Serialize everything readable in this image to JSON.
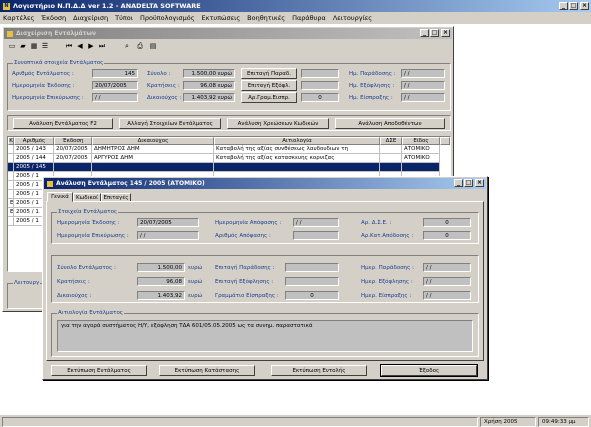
{
  "app": {
    "title": "Λογιστήριο Ν.Π.Δ.Δ  ver 1.2  -  ANADELTA SOFTWARE"
  },
  "menu": [
    "Καρτέλες",
    "Έκδοση",
    "Διαχείριση",
    "Τύποι",
    "Προϋπολογισμός",
    "Εκτυπώσεις",
    "Βοηθητικές",
    "Παράθυρα",
    "Λειτουργίες"
  ],
  "toolbar_icons": [
    "new-icon",
    "open-icon",
    "grid-icon",
    "table-icon",
    "first-record-icon",
    "prev-record-icon",
    "next-record-icon",
    "last-record-icon",
    "search-icon",
    "print-icon",
    "preview-icon"
  ],
  "mgmt": {
    "title": "Διαχείριση Ενταλμάτων",
    "group": "Συνοπτικά στοιχεία Εντάλματος",
    "fields": {
      "arithmos_label": "Αριθμός Εντάλματος :",
      "arithmos": "145",
      "ekdosi_label": "Ημερομηνία Έκδοσης :",
      "ekdosi": "20/07/2005",
      "epikyrosi_label": "Ημερομηνία Επικύρωσης :",
      "epikyrosi": "/ /",
      "synolo_label": "Σύνολο :",
      "synolo": "1.500,00 ευρώ",
      "kratiseis_label": "Κρατήσεις :",
      "kratiseis": "96,08 ευρώ",
      "dikaiouxos_label": "Δικαιούχος :",
      "dikaiouxos": "1.403,92 ευρώ",
      "epikt_parod_btn": "Επιταγή Παραδ.",
      "epikt_exof_btn": "Επιταγή Εξόφλ.",
      "ar_gram_btn": "Αρ.Γραμ.Εισπρ.",
      "ar_gram_val": "0",
      "parodosi_label": "Ημ. Παράδοσης :",
      "parodosi": "/ /",
      "exoflisi_label": "Ημ. Εξόφλησης :",
      "exoflisi": "/ /",
      "eispraxi_label": "Ημ. Είσπραξης :",
      "eispraxi": "/ /"
    },
    "buttons": [
      "Ανάλυση Εντάλματος   F2",
      "Αλλαγή Στοιχείων Εντάλματος",
      "Ανάλυση Χρεώσεων Κωδικών",
      "Ανάλυση Αποδοθέντων"
    ],
    "table": {
      "columns": [
        "Κ",
        "Αριθμός",
        "Έκδοση",
        "Δικαιούχος",
        "Αιτιολογία",
        "ΔΣΕ",
        "Είδος"
      ],
      "rows": [
        {
          "k": "",
          "num": "2005 / 143",
          "date": "20/07/2005",
          "who": "ΔΗΜΗΤΡΟΣ ΔΗΜ",
          "why": "Καταβολή της αξίας συνθέσεως λαυδουδιων τη",
          "dse": "",
          "kind": "ΑΤΟΜΙΚΟ"
        },
        {
          "k": "",
          "num": "2005 / 144",
          "date": "20/07/2005",
          "who": "ΑΡΓΥΡΟΣ ΔΗΜ",
          "why": "Καταβολή της αξίας κατασκευης  κορνιζας",
          "dse": "",
          "kind": "ΑΤΟΜΙΚΟ"
        },
        {
          "k": "",
          "num": "2005 / 145",
          "date": "",
          "who": "",
          "why": "",
          "dse": "",
          "kind": ""
        },
        {
          "k": "",
          "num": "2005 / 1",
          "date": "",
          "who": "",
          "why": "",
          "dse": "",
          "kind": ""
        },
        {
          "k": "",
          "num": "2005 / 1",
          "date": "",
          "who": "",
          "why": "",
          "dse": "",
          "kind": ""
        },
        {
          "k": "",
          "num": "2005 / 1",
          "date": "",
          "who": "",
          "why": "",
          "dse": "",
          "kind": ""
        },
        {
          "k": "Ε",
          "num": "2005 / 1",
          "date": "",
          "who": "",
          "why": "",
          "dse": "",
          "kind": ""
        },
        {
          "k": "Ε",
          "num": "2005 / 1",
          "date": "",
          "who": "",
          "why": "",
          "dse": "",
          "kind": ""
        },
        {
          "k": "",
          "num": "2005 / 1",
          "date": "",
          "who": "",
          "why": "",
          "dse": "",
          "kind": ""
        }
      ]
    },
    "bottom_group": "Λειτουργ"
  },
  "dialog": {
    "title": "Ανάλυση Εντάλματος 145 / 2005  (ΑΤΟΜΙΚΟ)",
    "tabs": [
      "Γενικά",
      "Κωδικοί",
      "Επιταγές"
    ],
    "g1_title": "Στοιχεία Εντάλματος",
    "ekdosi_label": "Ημερομηνία Έκδοσης :",
    "ekdosi": "20/07/2005",
    "epikyrosi_label": "Ημερομηνία Επικύρωσης :",
    "epikyrosi": "/ /",
    "apofasi_date_label": "Ημερομηνία Απόφασης :",
    "apofasi_date": "/ /",
    "apofasi_num_label": "Αριθμός Απόφασης :",
    "apofasi_num": "",
    "dse_label": "Αρ. Δ.Σ.Ε. :",
    "dse": "0",
    "ar_kat_label": "Αρ.Κατ.Απόδοσης :",
    "ar_kat": "0",
    "synolo_label": "Σύνολο Εντάλματος :",
    "synolo": "1.500,00",
    "kratiseis_label": "Κρατήσεις :",
    "kratiseis": "96,08",
    "dikaiouxos_label": "Δικαιούχος :",
    "dikaiouxos": "1.403,92",
    "euro": "ευρώ",
    "ep_parod_label": "Επιταγή Παράδοσης :",
    "ep_parod": "",
    "ep_exof_label": "Επιταγή Εξόφλησης :",
    "ep_exof": "",
    "gram_label": "Γραμμάτιο Είσπραξης :",
    "gram": "0",
    "hm_parod_label": "Ημερ. Παράδοσης :",
    "hm_parod": "/ /",
    "hm_exof_label": "Ημερ. Εξόφλησης :",
    "hm_exof": "/ /",
    "hm_eispr_label": "Ημερ. Είσπραξης :",
    "hm_eispr": "/ /",
    "aitiologia_title": "Αιτιολογία Εντάλματος",
    "aitiologia": "για την αγορά συστήματος Η/Υ, εξόφληση ΤΔΑ 601/05.05.2005 ως τα συνημ. παραστατικά",
    "buttons": [
      "Εκτύπωση Εντάλματος",
      "Εκτύπωση Κατάστασης",
      "Εκτύπωση Εντολής",
      "Έξοδος"
    ]
  },
  "status": {
    "year": "Χρήση  2005",
    "time": "09:49:33 μμ"
  }
}
